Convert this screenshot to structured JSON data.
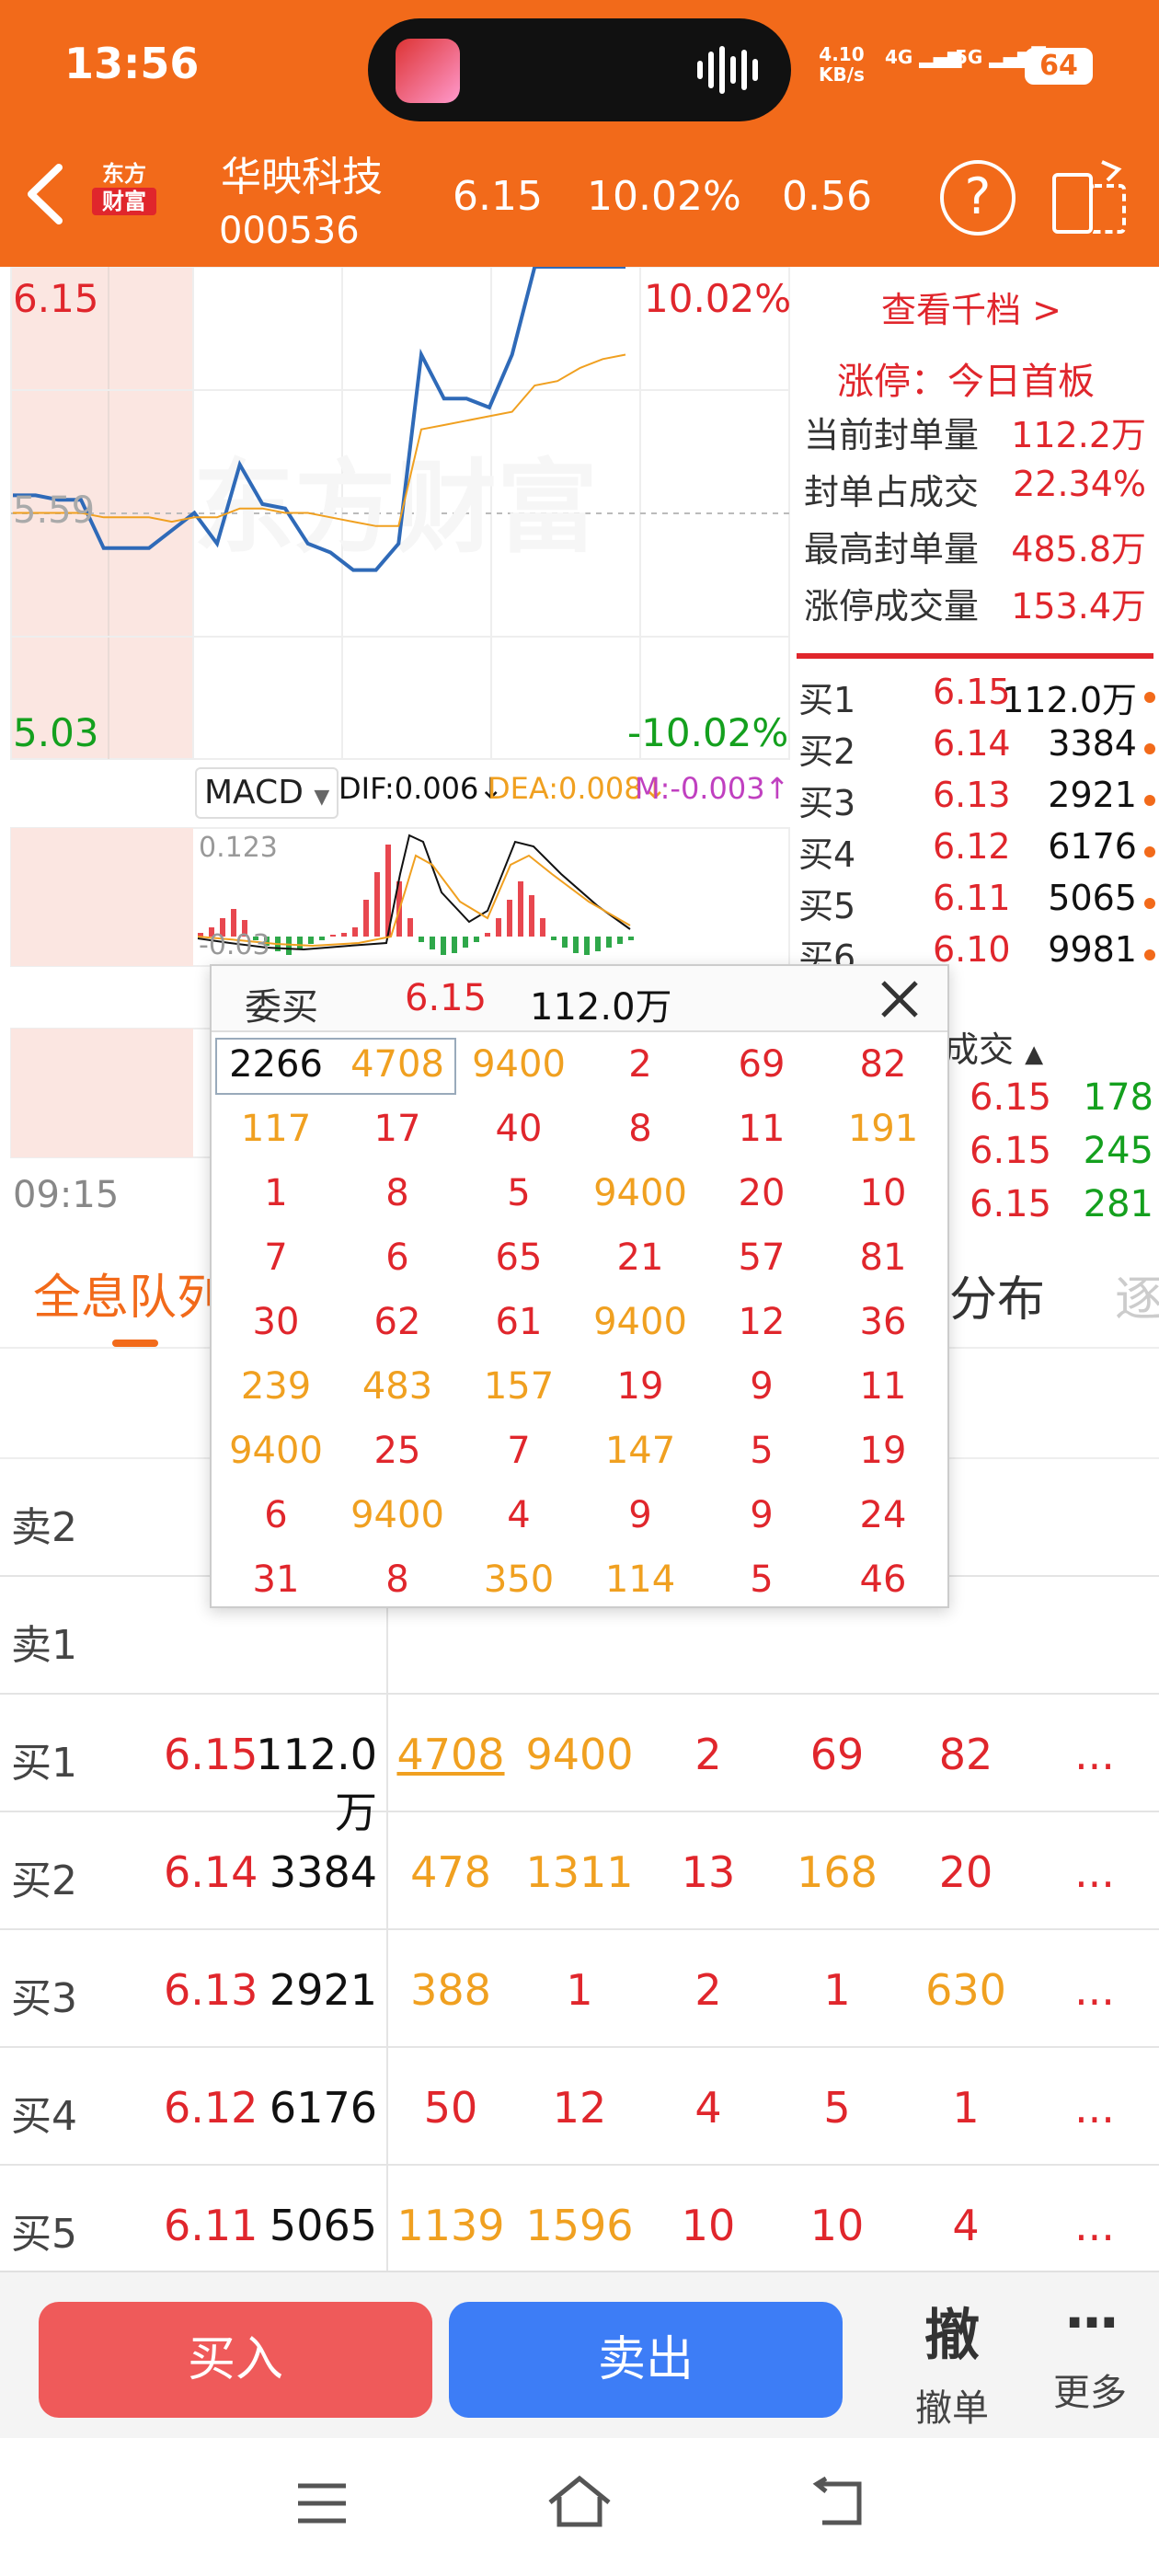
{
  "status": {
    "time": "13:56",
    "net_speed_value": "4.10",
    "net_speed_unit": "KB/s",
    "sig1": "4G",
    "sig2": "5G",
    "battery": "64"
  },
  "header": {
    "brand": [
      "东方",
      "财富"
    ],
    "stock_name": "华映科技",
    "stock_code": "000536",
    "price": "6.15",
    "pct": "10.02%",
    "change": "0.56"
  },
  "chart": {
    "price_high": "6.15",
    "price_mid": "5.59",
    "price_low": "5.03",
    "pct_high": "10.02%",
    "pct_low": "-10.02%",
    "watermark": "东方财富",
    "macd_label": "MACD",
    "dif": "DIF:0.006↓",
    "dea": "DEA:0.008↓",
    "m": "M:-0.003↑",
    "macd_top": "0.123",
    "macd_bottom": "-0.03",
    "time_start": "09:15"
  },
  "chart_data": {
    "type": "line",
    "series": [
      {
        "values": [
          5.63,
          5.63,
          5.62,
          5.62,
          5.51,
          5.51,
          5.51,
          5.55,
          5.59,
          5.52,
          5.7,
          5.61,
          5.6,
          5.52,
          5.5,
          5.46,
          5.46,
          5.52,
          5.95,
          5.85,
          5.85,
          5.83,
          5.95,
          6.15,
          6.15,
          6.15,
          6.15,
          6.15
        ]
      },
      {
        "values": [
          5.59,
          5.59,
          5.59,
          5.59,
          5.58,
          5.58,
          5.58,
          5.57,
          5.58,
          5.58,
          5.6,
          5.6,
          5.59,
          5.59,
          5.58,
          5.57,
          5.56,
          5.56,
          5.78,
          5.79,
          5.8,
          5.81,
          5.82,
          5.88,
          5.89,
          5.92,
          5.94,
          5.95
        ]
      }
    ],
    "ylim": [
      5.03,
      6.15
    ]
  },
  "right": {
    "view_depth": "查看千档 >",
    "limit_status": "涨停：今日首板",
    "seal_rows": [
      {
        "label": "当前封单量",
        "value": "112.2万"
      },
      {
        "label": "封单占成交",
        "value": "22.34%"
      },
      {
        "label": "最高封单量",
        "value": "485.8万"
      },
      {
        "label": "涨停成交量",
        "value": "153.4万"
      }
    ],
    "orderbook": [
      {
        "label": "买1",
        "price": "6.15",
        "vol": "112.0万"
      },
      {
        "label": "买2",
        "price": "6.14",
        "vol": "3384"
      },
      {
        "label": "买3",
        "price": "6.13",
        "vol": "2921"
      },
      {
        "label": "买4",
        "price": "6.12",
        "vol": "6176"
      },
      {
        "label": "买5",
        "price": "6.11",
        "vol": "5065"
      },
      {
        "label": "买6",
        "price": "6.10",
        "vol": "9981"
      }
    ],
    "trades_title": "成交",
    "trades": [
      {
        "price": "6.15",
        "vol": "178"
      },
      {
        "price": "6.15",
        "vol": "245"
      },
      {
        "price": "6.15",
        "vol": "281"
      }
    ]
  },
  "tabs": {
    "left": "全息队列",
    "right": "分布",
    "far_right": "逐"
  },
  "queue": {
    "rows": [
      {
        "label": "卖2",
        "price": "",
        "vol": "",
        "q": []
      },
      {
        "label": "卖1",
        "price": "",
        "vol": "",
        "q": []
      },
      {
        "label": "买1",
        "price": "6.15",
        "vol": "112.0万",
        "q": [
          "4708",
          "9400",
          "2",
          "69",
          "82"
        ]
      },
      {
        "label": "买2",
        "price": "6.14",
        "vol": "3384",
        "q": [
          "478",
          "1311",
          "13",
          "168",
          "20"
        ]
      },
      {
        "label": "买3",
        "price": "6.13",
        "vol": "2921",
        "q": [
          "388",
          "1",
          "2",
          "1",
          "630"
        ]
      },
      {
        "label": "买4",
        "price": "6.12",
        "vol": "6176",
        "q": [
          "50",
          "12",
          "4",
          "5",
          "1"
        ]
      },
      {
        "label": "买5",
        "price": "6.11",
        "vol": "5065",
        "q": [
          "1139",
          "1596",
          "10",
          "10",
          "4"
        ]
      }
    ],
    "more": "..."
  },
  "popup": {
    "title": "委买",
    "price": "6.15",
    "volume": "112.0万",
    "grid": [
      [
        "2266",
        "4708",
        "9400",
        "2",
        "69",
        "82"
      ],
      [
        "117",
        "17",
        "40",
        "8",
        "11",
        "191"
      ],
      [
        "1",
        "8",
        "5",
        "9400",
        "20",
        "10"
      ],
      [
        "7",
        "6",
        "65",
        "21",
        "57",
        "81"
      ],
      [
        "30",
        "62",
        "61",
        "9400",
        "12",
        "36"
      ],
      [
        "239",
        "483",
        "157",
        "19",
        "9",
        "11"
      ],
      [
        "9400",
        "25",
        "7",
        "147",
        "5",
        "19"
      ],
      [
        "6",
        "9400",
        "4",
        "9",
        "9",
        "24"
      ],
      [
        "31",
        "8",
        "350",
        "114",
        "5",
        "46"
      ]
    ]
  },
  "actions": {
    "buy": "买入",
    "sell": "卖出",
    "cancel_icon": "撤",
    "cancel": "撤单",
    "more_icon": "···",
    "more": "更多"
  }
}
